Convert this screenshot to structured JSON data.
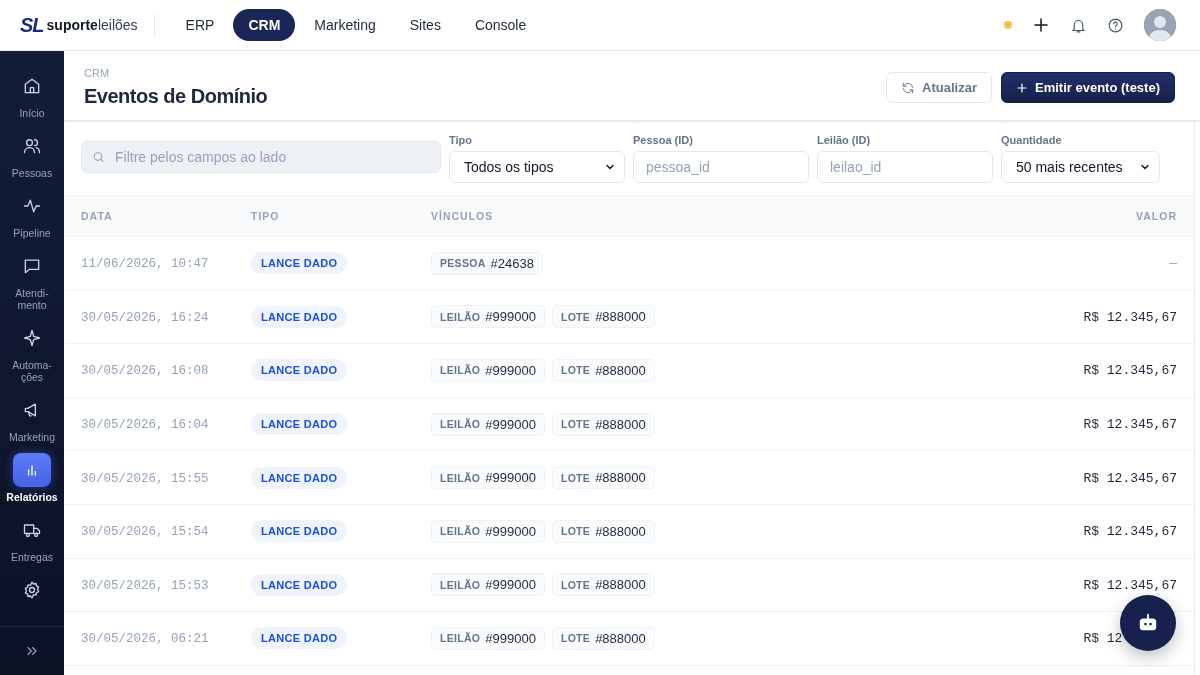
{
  "brand": {
    "mark": "SL",
    "name": "suporte",
    "name_light": "leilões"
  },
  "top_nav": [
    {
      "label": "ERP",
      "selected": false
    },
    {
      "label": "CRM",
      "selected": true
    },
    {
      "label": "Marketing",
      "selected": false
    },
    {
      "label": "Sites",
      "selected": false
    },
    {
      "label": "Console",
      "selected": false
    }
  ],
  "sidebar": {
    "items": [
      {
        "kind": "home",
        "label": "Início",
        "selected": false
      },
      {
        "kind": "users",
        "label": "Pessoas",
        "selected": false
      },
      {
        "kind": "pulse",
        "label": "Pipeline",
        "selected": false
      },
      {
        "kind": "chat",
        "label": "Atendi-\nmento",
        "selected": false
      },
      {
        "kind": "sparkle",
        "label": "Automa-\nções",
        "selected": false
      },
      {
        "kind": "megaphone",
        "label": "Marketing",
        "selected": false
      },
      {
        "kind": "chart",
        "label": "Relatórios",
        "selected": true
      },
      {
        "kind": "truck",
        "label": "Entregas",
        "selected": false
      },
      {
        "kind": "gear",
        "selected": false
      }
    ]
  },
  "page": {
    "breadcrumb": "CRM",
    "title": "Eventos de Domínio",
    "buttons": [
      {
        "kind": "secondary",
        "label": "Atualizar"
      },
      {
        "kind": "primary",
        "label": "Emitir evento (teste)"
      }
    ]
  },
  "filters": {
    "search": {
      "placeholder": "Filtre pelos campos ao lado"
    },
    "fields": [
      {
        "kind": "select",
        "label": "Tipo",
        "value": "Todos os tipos"
      },
      {
        "kind": "input",
        "label": "Pessoa (ID)",
        "placeholder": "pessoa_id"
      },
      {
        "kind": "input",
        "label": "Leilão (ID)",
        "placeholder": "leilao_id"
      },
      {
        "kind": "select",
        "label": "Quantidade",
        "value": "50 mais recentes"
      }
    ]
  },
  "table": {
    "columns": [
      "DATA",
      "TIPO",
      "VÍNCULOS",
      "VALOR"
    ],
    "rows": [
      {
        "data": "11/06/2026, 10:47",
        "tipo": "LANCE DADO",
        "vinculos": [
          {
            "label": "PESSOA",
            "value": "#24638"
          }
        ],
        "valor": "—"
      },
      {
        "data": "30/05/2026, 16:24",
        "tipo": "LANCE DADO",
        "vinculos": [
          {
            "label": "LEILÃO",
            "value": "#999000"
          },
          {
            "label": "LOTE",
            "value": "#888000"
          }
        ],
        "valor": "R$ 12.345,67"
      },
      {
        "data": "30/05/2026, 16:08",
        "tipo": "LANCE DADO",
        "vinculos": [
          {
            "label": "LEILÃO",
            "value": "#999000"
          },
          {
            "label": "LOTE",
            "value": "#888000"
          }
        ],
        "valor": "R$ 12.345,67"
      },
      {
        "data": "30/05/2026, 16:04",
        "tipo": "LANCE DADO",
        "vinculos": [
          {
            "label": "LEILÃO",
            "value": "#999000"
          },
          {
            "label": "LOTE",
            "value": "#888000"
          }
        ],
        "valor": "R$ 12.345,67"
      },
      {
        "data": "30/05/2026, 15:55",
        "tipo": "LANCE DADO",
        "vinculos": [
          {
            "label": "LEILÃO",
            "value": "#999000"
          },
          {
            "label": "LOTE",
            "value": "#888000"
          }
        ],
        "valor": "R$ 12.345,67"
      },
      {
        "data": "30/05/2026, 15:54",
        "tipo": "LANCE DADO",
        "vinculos": [
          {
            "label": "LEILÃO",
            "value": "#999000"
          },
          {
            "label": "LOTE",
            "value": "#888000"
          }
        ],
        "valor": "R$ 12.345,67"
      },
      {
        "data": "30/05/2026, 15:53",
        "tipo": "LANCE DADO",
        "vinculos": [
          {
            "label": "LEILÃO",
            "value": "#999000"
          },
          {
            "label": "LOTE",
            "value": "#888000"
          }
        ],
        "valor": "R$ 12.345,67"
      },
      {
        "data": "30/05/2026, 06:21",
        "tipo": "LANCE DADO",
        "vinculos": [
          {
            "label": "LEILÃO",
            "value": "#999000"
          },
          {
            "label": "LOTE",
            "value": "#888000"
          }
        ],
        "valor": "R$ 12"
      }
    ]
  }
}
